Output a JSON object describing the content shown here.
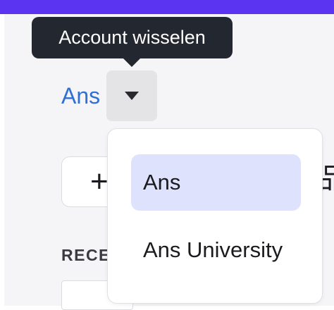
{
  "header": {
    "color": "#5b34f1"
  },
  "account": {
    "name": "Ans",
    "name_color": "#2f6fd6",
    "switch_tooltip": "Account wisselen",
    "caret_icon": "caret-down-icon"
  },
  "toolbar": {
    "add_label": "+"
  },
  "recent": {
    "label": "RECE"
  },
  "dropdown": {
    "items": [
      {
        "label": "Ans",
        "selected": true
      },
      {
        "label": "Ans University",
        "selected": false
      }
    ],
    "selected_color": "#dfe2fc"
  },
  "partial_glyph": "品"
}
